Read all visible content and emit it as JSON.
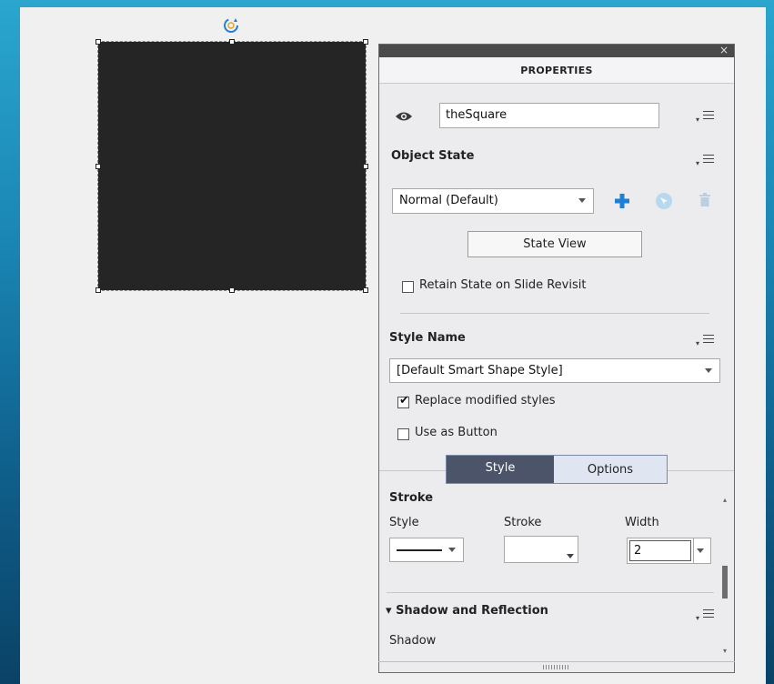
{
  "panel": {
    "title": "PROPERTIES",
    "close_glyph": "×"
  },
  "object": {
    "name": "theSquare"
  },
  "object_state": {
    "heading": "Object State",
    "selected_state": "Normal (Default)",
    "state_view_label": "State View",
    "retain_label": "Retain State on Slide Revisit",
    "retain_checked": false
  },
  "style_name": {
    "heading": "Style Name",
    "selected": "[Default Smart Shape Style]",
    "replace_label": "Replace modified styles",
    "replace_checked": true,
    "use_button_label": "Use as Button",
    "use_button_checked": false
  },
  "tabs": {
    "style": "Style",
    "options": "Options",
    "active": "Style"
  },
  "stroke": {
    "heading": "Stroke",
    "style_label": "Style",
    "stroke_label": "Stroke",
    "width_label": "Width",
    "width_value": "2"
  },
  "shadow": {
    "heading": "Shadow and Reflection",
    "arrow": "▾",
    "shadow_label": "Shadow"
  },
  "icons": [
    "eye-icon",
    "menu-icon",
    "plus-icon",
    "rotate-icon",
    "trash-icon",
    "rotate-handle-icon"
  ],
  "colors": {
    "accent_blue": "#1f7ed6",
    "square_fill": "#252525",
    "active_tab": "#4b5468"
  }
}
